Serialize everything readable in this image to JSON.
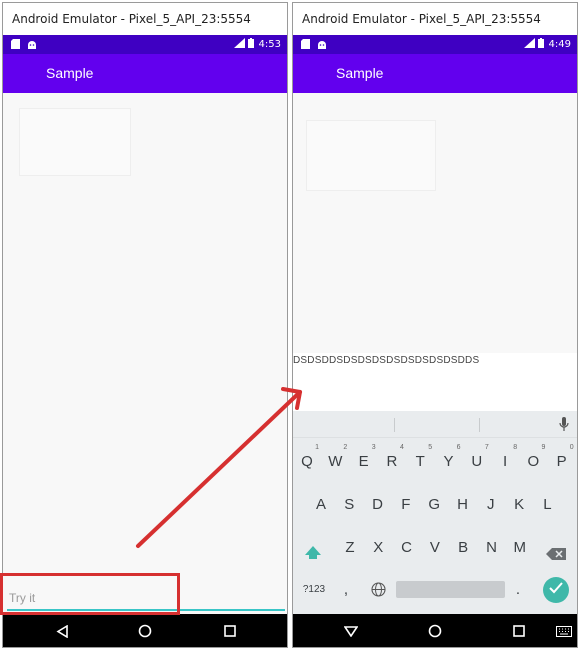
{
  "left": {
    "window_title": "Android Emulator - Pixel_5_API_23:5554",
    "status_time": "4:53",
    "app_title": "Sample",
    "entry_placeholder": "Try it"
  },
  "right": {
    "window_title": "Android Emulator - Pixel_5_API_23:5554",
    "status_time": "4:49",
    "app_title": "Sample",
    "entry_text": "DSDSDDSDSDSDSDSDSDSDSDSDDS",
    "keyboard": {
      "row1": [
        {
          "key": "Q",
          "hint": "1"
        },
        {
          "key": "W",
          "hint": "2"
        },
        {
          "key": "E",
          "hint": "3"
        },
        {
          "key": "R",
          "hint": "4"
        },
        {
          "key": "T",
          "hint": "5"
        },
        {
          "key": "Y",
          "hint": "6"
        },
        {
          "key": "U",
          "hint": "7"
        },
        {
          "key": "I",
          "hint": "8"
        },
        {
          "key": "O",
          "hint": "9"
        },
        {
          "key": "P",
          "hint": "0"
        }
      ],
      "row2": [
        "A",
        "S",
        "D",
        "F",
        "G",
        "H",
        "J",
        "K",
        "L"
      ],
      "row3": [
        "Z",
        "X",
        "C",
        "V",
        "B",
        "N",
        "M"
      ],
      "symbols_key": "?123",
      "comma_key": ",",
      "period_key": "."
    }
  },
  "colors": {
    "app_bar": "#6200ee",
    "status_bar": "#3f00c2",
    "entry_underline": "#39c5c7",
    "annotation": "#d63030",
    "enter_key": "#3fb8a9"
  }
}
